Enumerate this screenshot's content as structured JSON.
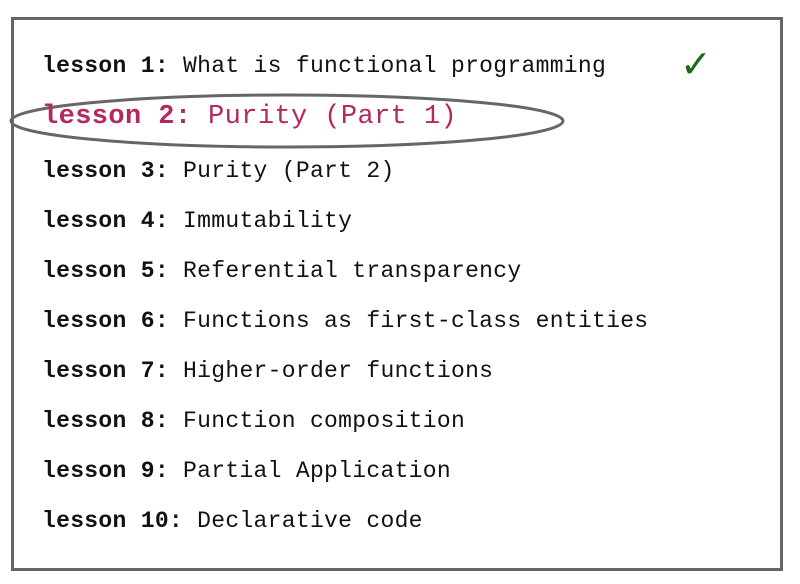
{
  "lessons": [
    {
      "number": "lesson 1:",
      "title": "What is functional programming",
      "completed": true,
      "current": false
    },
    {
      "number": "lesson 2:",
      "title": "Purity (Part 1)",
      "completed": false,
      "current": true
    },
    {
      "number": "lesson 3:",
      "title": "Purity (Part 2)",
      "completed": false,
      "current": false
    },
    {
      "number": "lesson 4:",
      "title": "Immutability",
      "completed": false,
      "current": false
    },
    {
      "number": "lesson 5:",
      "title": "Referential transparency",
      "completed": false,
      "current": false
    },
    {
      "number": "lesson 6:",
      "title": "Functions as first-class entities",
      "completed": false,
      "current": false
    },
    {
      "number": "lesson 7:",
      "title": "Higher-order functions",
      "completed": false,
      "current": false
    },
    {
      "number": "lesson 8:",
      "title": "Function composition",
      "completed": false,
      "current": false
    },
    {
      "number": "lesson 9:",
      "title": "Partial Application",
      "completed": false,
      "current": false
    },
    {
      "number": "lesson 10:",
      "title": "Declarative code",
      "completed": false,
      "current": false
    }
  ],
  "completed_mark": "✓",
  "icons": {
    "completed": "check-icon",
    "current": "ellipse-highlight"
  },
  "colors": {
    "current_lesson": "#b5285f",
    "check": "#1b6b12",
    "frame": "#666666"
  }
}
